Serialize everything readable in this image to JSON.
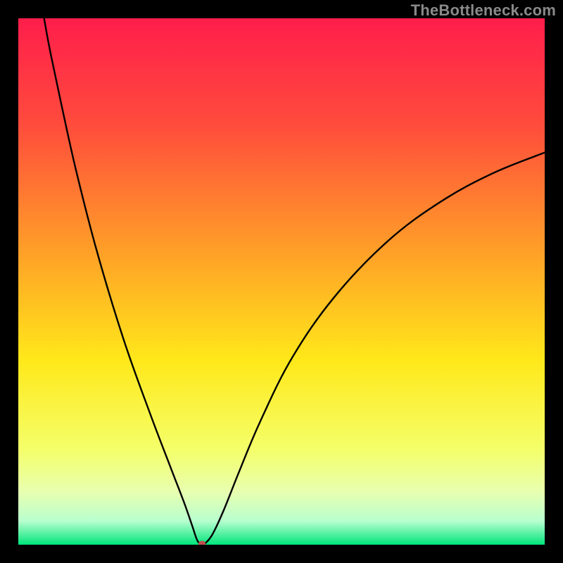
{
  "watermark": "TheBottleneck.com",
  "chart_data": {
    "type": "line",
    "title": "",
    "xlabel": "",
    "ylabel": "",
    "xlim": [
      0,
      100
    ],
    "ylim": [
      0,
      100
    ],
    "grid": false,
    "legend": false,
    "background_gradient_stops": [
      {
        "offset": 0.0,
        "color": "#ff1e4b"
      },
      {
        "offset": 0.2,
        "color": "#ff4b3c"
      },
      {
        "offset": 0.45,
        "color": "#ffa227"
      },
      {
        "offset": 0.65,
        "color": "#ffe81a"
      },
      {
        "offset": 0.82,
        "color": "#f4ff6a"
      },
      {
        "offset": 0.9,
        "color": "#e8ffb0"
      },
      {
        "offset": 0.955,
        "color": "#b8ffcf"
      },
      {
        "offset": 1.0,
        "color": "#00e47a"
      }
    ],
    "curve_points": [
      {
        "x": 4.9,
        "y": 100.0
      },
      {
        "x": 6.0,
        "y": 94.0
      },
      {
        "x": 8.0,
        "y": 84.5
      },
      {
        "x": 11.0,
        "y": 71.0
      },
      {
        "x": 15.0,
        "y": 55.5
      },
      {
        "x": 20.0,
        "y": 39.0
      },
      {
        "x": 25.0,
        "y": 25.0
      },
      {
        "x": 29.0,
        "y": 14.5
      },
      {
        "x": 31.5,
        "y": 8.0
      },
      {
        "x": 33.0,
        "y": 3.7
      },
      {
        "x": 33.8,
        "y": 1.3
      },
      {
        "x": 34.3,
        "y": 0.35
      },
      {
        "x": 34.9,
        "y": 0.05
      },
      {
        "x": 35.6,
        "y": 0.35
      },
      {
        "x": 36.9,
        "y": 2.0
      },
      {
        "x": 39.0,
        "y": 6.5
      },
      {
        "x": 42.0,
        "y": 14.0
      },
      {
        "x": 46.0,
        "y": 23.5
      },
      {
        "x": 52.0,
        "y": 35.5
      },
      {
        "x": 60.0,
        "y": 47.0
      },
      {
        "x": 70.0,
        "y": 57.5
      },
      {
        "x": 80.0,
        "y": 65.0
      },
      {
        "x": 90.0,
        "y": 70.5
      },
      {
        "x": 100.0,
        "y": 74.5
      }
    ],
    "marker": {
      "x": 34.9,
      "y": 0.2,
      "color": "#c0504d",
      "rx": 5,
      "ry": 4
    }
  }
}
